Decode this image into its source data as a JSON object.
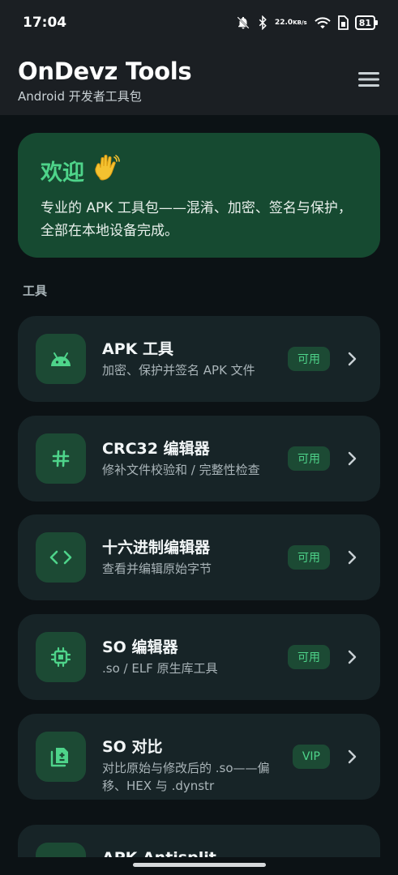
{
  "status_bar": {
    "time": "17:04",
    "speed_value": "22.0",
    "speed_unit": "KB/s",
    "battery": "81",
    "icons": [
      "dnd-off-icon",
      "bluetooth-icon",
      "wifi-icon",
      "sim-icon",
      "battery-icon"
    ]
  },
  "app_bar": {
    "title": "OnDevz Tools",
    "subtitle": "Android 开发者工具包",
    "menu_icon": "menu-icon"
  },
  "welcome": {
    "title": "欢迎",
    "emoji": "👋",
    "text": "专业的 APK 工具包——混淆、加密、签名与保护，全部在本地设备完成。"
  },
  "section_label": "工具",
  "tools": [
    {
      "name": "APK 工具",
      "desc": "加密、保护并签名 APK 文件",
      "badge": "可用",
      "icon": "android-icon"
    },
    {
      "name": "CRC32 编辑器",
      "desc": "修补文件校验和 / 完整性检查",
      "badge": "可用",
      "icon": "hash-icon"
    },
    {
      "name": "十六进制编辑器",
      "desc": "查看并编辑原始字节",
      "badge": "可用",
      "icon": "code-icon"
    },
    {
      "name": "SO 编辑器",
      "desc": ".so / ELF 原生库工具",
      "badge": "可用",
      "icon": "chip-icon"
    },
    {
      "name": "SO 对比",
      "desc": "对比原始与修改后的 .so——偏移、HEX 与 .dynstr",
      "badge": "VIP",
      "icon": "compare-doc-icon"
    },
    {
      "name": "APK Antisplit",
      "desc": "",
      "badge": "",
      "icon": "merge-icon"
    }
  ],
  "colors": {
    "accent": "#4ed48a",
    "card": "#172427",
    "icon_bg": "#1c4a34",
    "welcome_bg": "#164a31",
    "background": "#0c1215"
  }
}
